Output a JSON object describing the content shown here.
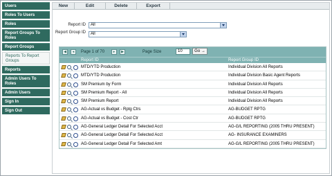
{
  "sidebar": {
    "items": [
      {
        "label": "Users",
        "lines": 1,
        "active": false
      },
      {
        "label": "Roles To Users",
        "lines": 1,
        "active": false
      },
      {
        "label": "Roles",
        "lines": 1,
        "active": false
      },
      {
        "label": "Report Groups To Roles",
        "lines": 2,
        "active": false
      },
      {
        "label": "Report Groups",
        "lines": 1,
        "active": false
      },
      {
        "label": "Reports To Report Groups",
        "lines": 2,
        "active": true
      },
      {
        "label": "Reports",
        "lines": 1,
        "active": false
      },
      {
        "label": "Admin Users To Roles",
        "lines": 2,
        "active": false
      },
      {
        "label": "Admin Users",
        "lines": 1,
        "active": false
      },
      {
        "label": "Sign In",
        "lines": 1,
        "active": false
      },
      {
        "label": "Sign Out",
        "lines": 1,
        "active": false
      }
    ]
  },
  "toolbar": {
    "new": "New",
    "edit": "Edit",
    "delete": "Delete",
    "export": "Export"
  },
  "filters": {
    "report_id_label": "Report ID",
    "report_id_value": "All",
    "report_group_label": "Report Group ID",
    "report_group_value": "All"
  },
  "pager": {
    "page_text": "Page 1 of 70",
    "page_size_label": "Page Size",
    "page_size": "10",
    "go": "Go →"
  },
  "table": {
    "columns": [
      "Report ID",
      "Report Group ID"
    ],
    "rows": [
      [
        "MTD/YTD Production",
        "Individual Division All Reports"
      ],
      [
        "MTD/YTD Production",
        "Individual Division Basic Agent Reports"
      ],
      [
        "SM Premium by Form",
        "Individual Division All Reports"
      ],
      [
        "SM Premium Report - All",
        "Individual Division All Reports"
      ],
      [
        "SM Premium Report",
        "Individual Division All Reports"
      ],
      [
        "AG-Actual vs Budget - Rptg Ctrs",
        "AG-BUDGET RPTG"
      ],
      [
        "AG-Actual vs Budget - Cost Ctr",
        "AG-BUDGET RPTG"
      ],
      [
        "AG-General Ledger Detail For Selected Acct",
        "AG-G/L REPORTING (2005 THRU PRESENT)"
      ],
      [
        "AG-General Ledger Detail For Selected Acct",
        "AG-     INSURANCE EXAMINERS"
      ],
      [
        "AG-General Ledger Detail For Selected Amt",
        "AG-G/L REPORTING (2005 THRU PRESENT)"
      ]
    ]
  }
}
